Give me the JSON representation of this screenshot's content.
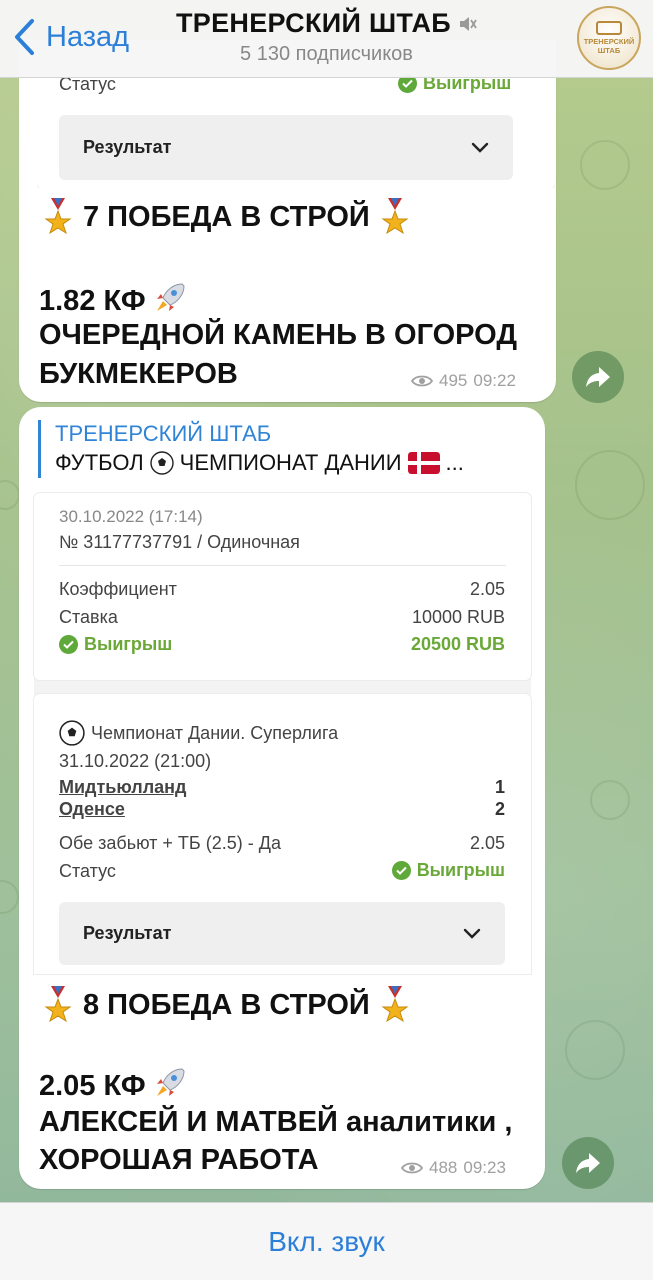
{
  "header": {
    "back_label": "Назад",
    "title": "ТРЕНЕРСКИЙ ШТАБ",
    "subscribers": "5 130 подписчиков",
    "avatar_text": "ТРЕНЕРСКИЙ ШТАБ"
  },
  "message1": {
    "status_label": "Статус",
    "status_value": "Выигрыш",
    "result_button": "Результат",
    "headline": "7 ПОБЕДА В СТРОЙ",
    "coef_line": "1.82 КФ",
    "line2": "ОЧЕРЕДНОЙ КАМЕНЬ В ОГОРОД",
    "line3": "БУКМЕКЕРОВ",
    "views": "495",
    "time": "09:22"
  },
  "message2": {
    "forward_from": "ТРЕНЕРСКИЙ ШТАБ",
    "forward_text": "ФУТБОЛ",
    "forward_text2": "ЧЕМПИОНАТ ДАНИИ",
    "forward_ellipsis": "...",
    "bet": {
      "datetime": "30.10.2022 (17:14)",
      "number": "№ 31177737791 / Одиночная",
      "coef_label": "Коэффициент",
      "coef_value": "2.05",
      "stake_label": "Ставка",
      "stake_value": "10000 RUB",
      "win_label": "Выигрыш",
      "win_value": "20500 RUB"
    },
    "event": {
      "league": "Чемпионат Дании. Суперлига",
      "datetime": "31.10.2022 (21:00)",
      "team1": "Мидтьюлланд",
      "score1": "1",
      "team2": "Оденсе",
      "score2": "2",
      "market": "Обе забьют + ТБ (2.5) - Да",
      "market_coef": "2.05",
      "status_label": "Статус",
      "status_value": "Выигрыш",
      "result_button": "Результат"
    },
    "headline": "8 ПОБЕДА В СТРОЙ",
    "coef_line": "2.05 КФ",
    "line2": "АЛЕКСЕЙ И МАТВЕЙ аналитики ,",
    "line3": "ХОРОШАЯ РАБОТА",
    "views": "488",
    "time": "09:23"
  },
  "bottom": {
    "unmute_label": "Вкл. звук"
  },
  "colors": {
    "accent": "#2b7fd8",
    "win_green": "#6aa838",
    "forward_blue": "#2f84d6"
  }
}
